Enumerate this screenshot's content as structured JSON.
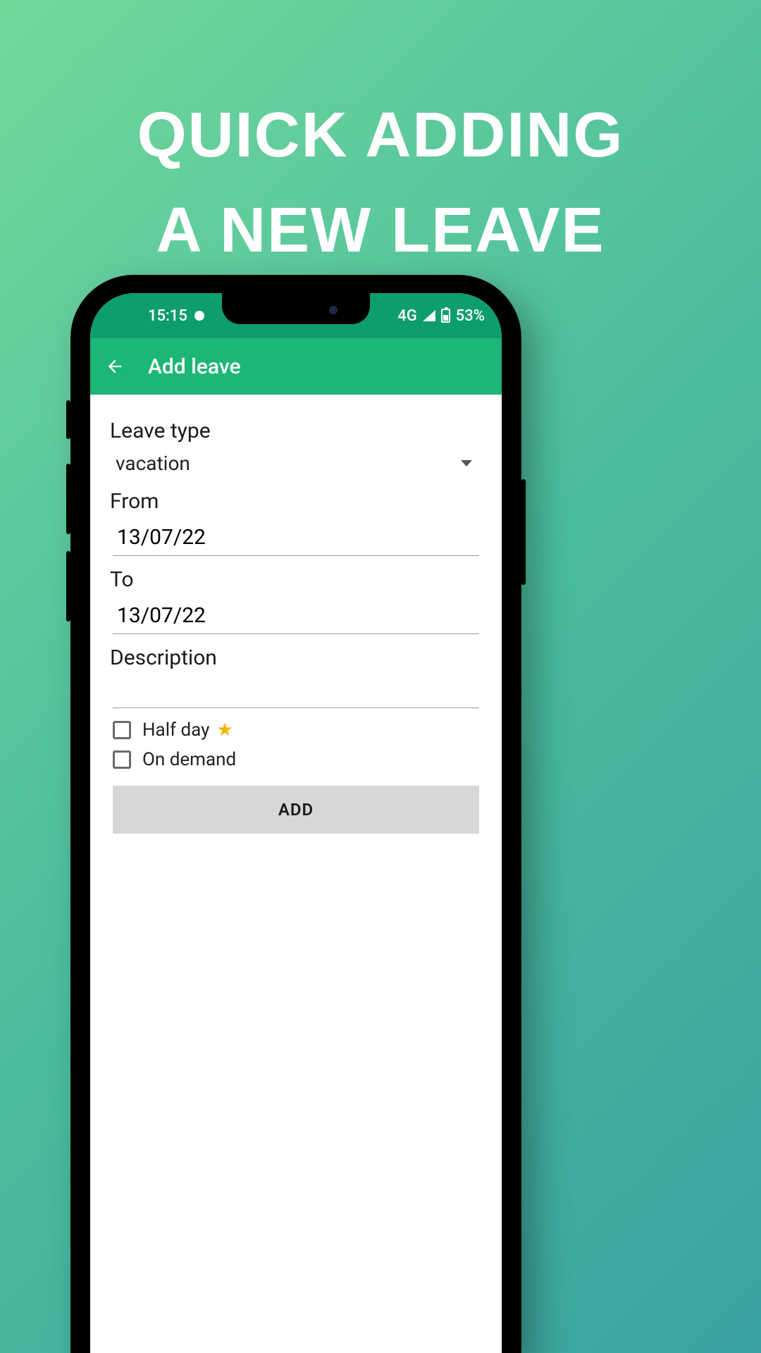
{
  "promo": {
    "line1": "QUICK ADDING",
    "line2": "A NEW LEAVE"
  },
  "statusbar": {
    "time": "15:15",
    "network": "4G",
    "battery": "53%"
  },
  "appbar": {
    "title": "Add leave"
  },
  "form": {
    "leave_type_label": "Leave type",
    "leave_type_value": "vacation",
    "from_label": "From",
    "from_value": "13/07/22",
    "to_label": "To",
    "to_value": "13/07/22",
    "description_label": "Description",
    "description_value": "",
    "half_day_label": "Half day",
    "on_demand_label": "On demand",
    "add_button_label": "ADD"
  }
}
